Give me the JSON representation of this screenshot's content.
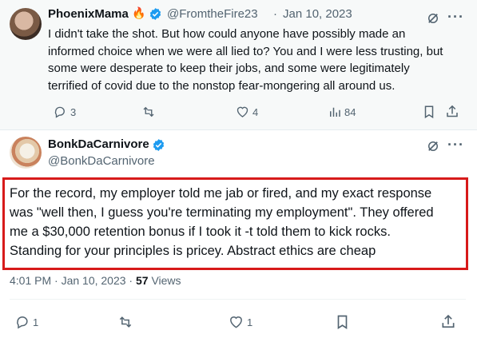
{
  "tweet1": {
    "name": "PhoenixMama",
    "handle": "@FromtheFire23",
    "separator": "·",
    "date": "Jan 10, 2023",
    "lines": [
      "I didn't take the shot. But how could anyone have possibly made an",
      "informed choice when we were all lied to?  You and I were less trusting, but",
      "some were desperate to keep their jobs, and some were legitimately",
      "terrified of covid due to the nonstop fear-mongering all around us."
    ],
    "replies": "3",
    "likes": "4",
    "views": "84"
  },
  "tweet2": {
    "name": "BonkDaCarnivore",
    "handle": "@BonkDaCarnivore",
    "lines": [
      "For the record, my employer told me jab or fired, and my exact response",
      "was \"well then, I guess you're terminating my employment\".  They offered",
      "me a $30,000 retention bonus if I took it -t told them to kick rocks.",
      "Standing for your principles is pricey. Abstract ethics are cheap"
    ],
    "time": "4:01 PM · Jan 10, 2023 · ",
    "views_count": "57",
    "views_label": " Views",
    "replies": "1",
    "likes": "1"
  },
  "colors": {
    "accent": "#1d9bf0",
    "highlight_box": "#d71a1a",
    "muted": "#536471"
  }
}
